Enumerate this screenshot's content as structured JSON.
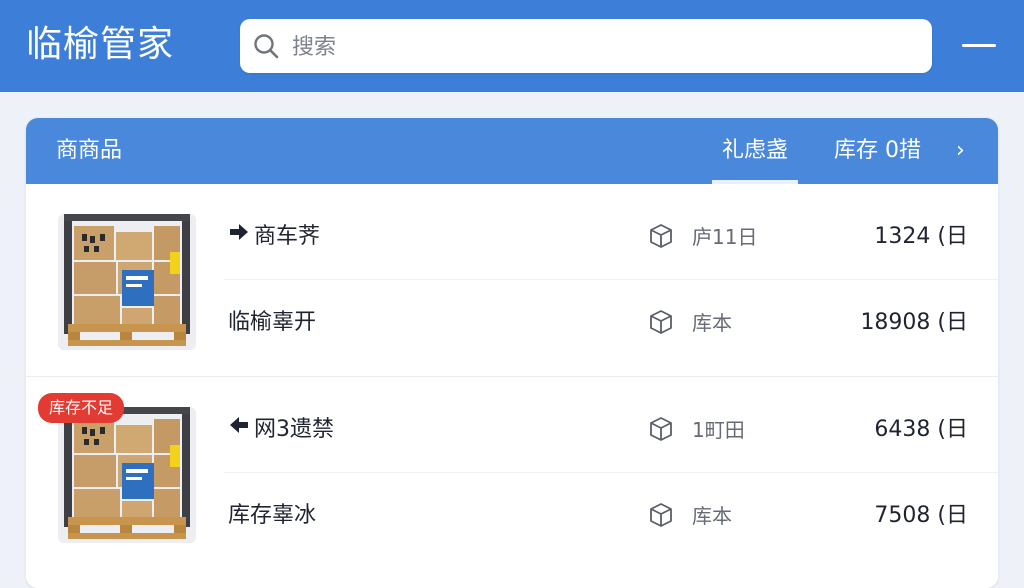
{
  "app": {
    "title": "临榆管家"
  },
  "search": {
    "placeholder": "搜索",
    "value": ""
  },
  "section": {
    "title": "商商品",
    "tab_active": "礼虑盏",
    "stock_label": "库存  0措",
    "chevron": "›"
  },
  "groups": [
    {
      "image": "pallet-of-boxes",
      "badge": "",
      "items": [
        {
          "arrow": "right",
          "name": "商车荠",
          "meta": "庐11日",
          "value": "1324 (日"
        },
        {
          "arrow": "",
          "name": "临榆辜开",
          "meta": "库本",
          "value": "18908 (日"
        }
      ]
    },
    {
      "image": "pallet-of-boxes",
      "badge": "库存不足",
      "items": [
        {
          "arrow": "left",
          "name": "网3遗禁",
          "meta": "1町田",
          "value": "6438 (日"
        },
        {
          "arrow": "",
          "name": "库存辜冰",
          "meta": "库本",
          "value": "7508 (日"
        }
      ]
    }
  ],
  "colors": {
    "topbar": "#3d7ed8",
    "section_header": "#4a88dc",
    "badge": "#e13b33",
    "background": "#eef2f8"
  }
}
